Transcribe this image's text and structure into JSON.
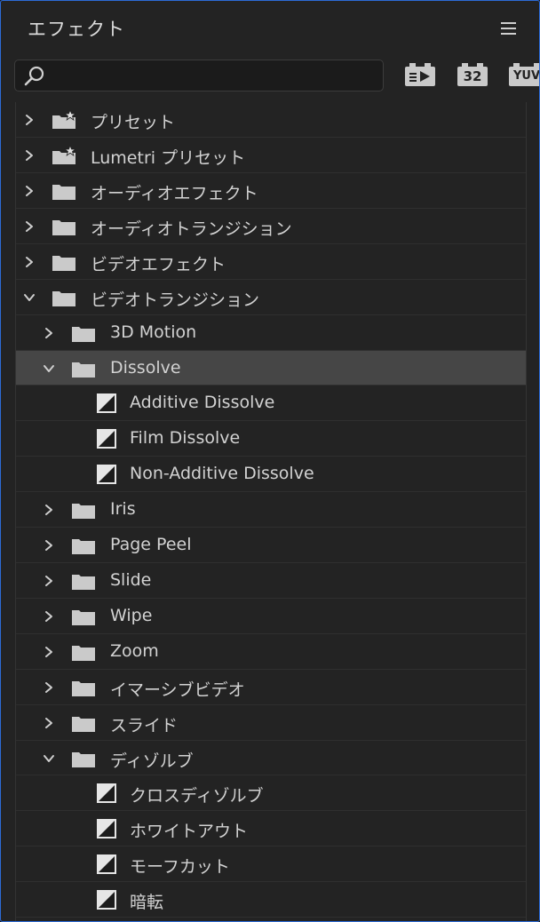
{
  "panel": {
    "title": "エフェクト",
    "menu_icon": "hamburger-menu-icon"
  },
  "search": {
    "value": "",
    "placeholder": "",
    "icon": "search-icon"
  },
  "filters": [
    {
      "name": "accelerated-effects-filter",
      "icon": "accelerated-effects-icon"
    },
    {
      "name": "32bit-color-filter",
      "label": "32"
    },
    {
      "name": "yuv-filter",
      "label": "YUV"
    }
  ],
  "tree": [
    {
      "label": "プリセット",
      "level": 0,
      "kind": "preset-folder",
      "expanded": false
    },
    {
      "label": "Lumetri プリセット",
      "level": 0,
      "kind": "preset-folder",
      "expanded": false
    },
    {
      "label": "オーディオエフェクト",
      "level": 0,
      "kind": "folder",
      "expanded": false
    },
    {
      "label": "オーディオトランジション",
      "level": 0,
      "kind": "folder",
      "expanded": false
    },
    {
      "label": "ビデオエフェクト",
      "level": 0,
      "kind": "folder",
      "expanded": false
    },
    {
      "label": "ビデオトランジション",
      "level": 0,
      "kind": "folder",
      "expanded": true
    },
    {
      "label": "3D Motion",
      "level": 1,
      "kind": "folder",
      "expanded": false
    },
    {
      "label": "Dissolve",
      "level": 1,
      "kind": "folder",
      "expanded": true,
      "selected": true
    },
    {
      "label": "Additive Dissolve",
      "level": 2,
      "kind": "effect"
    },
    {
      "label": "Film Dissolve",
      "level": 2,
      "kind": "effect"
    },
    {
      "label": "Non-Additive Dissolve",
      "level": 2,
      "kind": "effect"
    },
    {
      "label": "Iris",
      "level": 1,
      "kind": "folder",
      "expanded": false
    },
    {
      "label": "Page Peel",
      "level": 1,
      "kind": "folder",
      "expanded": false
    },
    {
      "label": "Slide",
      "level": 1,
      "kind": "folder",
      "expanded": false
    },
    {
      "label": "Wipe",
      "level": 1,
      "kind": "folder",
      "expanded": false
    },
    {
      "label": "Zoom",
      "level": 1,
      "kind": "folder",
      "expanded": false
    },
    {
      "label": "イマーシブビデオ",
      "level": 1,
      "kind": "folder",
      "expanded": false
    },
    {
      "label": "スライド",
      "level": 1,
      "kind": "folder",
      "expanded": false
    },
    {
      "label": "ディゾルブ",
      "level": 1,
      "kind": "folder",
      "expanded": true
    },
    {
      "label": "クロスディゾルブ",
      "level": 2,
      "kind": "effect"
    },
    {
      "label": "ホワイトアウト",
      "level": 2,
      "kind": "effect"
    },
    {
      "label": "モーフカット",
      "level": 2,
      "kind": "effect"
    },
    {
      "label": "暗転",
      "level": 2,
      "kind": "effect"
    }
  ],
  "colors": {
    "accent_border": "#2d6bd6",
    "selected_row": "#464646",
    "panel_bg": "#232323"
  }
}
